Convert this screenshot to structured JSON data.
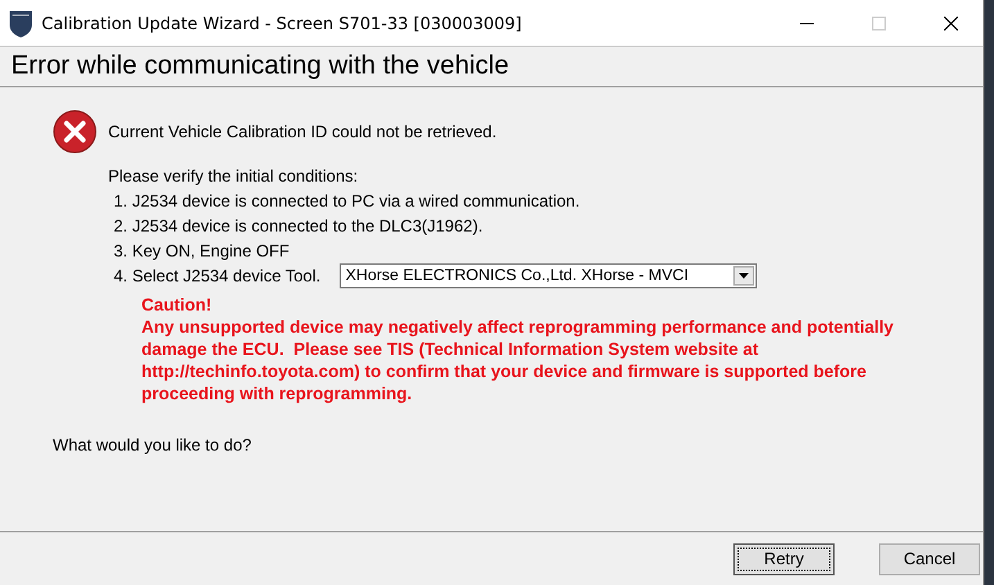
{
  "window": {
    "title": "Calibration Update Wizard - Screen S701-33 [030003009]"
  },
  "header": "Error while communicating with the vehicle",
  "message": "Current Vehicle Calibration ID could not be retrieved.",
  "intro": "Please verify the initial conditions:",
  "conditions": [
    {
      "kind": "text",
      "text": "1. J2534 device is connected to PC via a wired communication."
    },
    {
      "kind": "text",
      "text": "2. J2534 device is connected to the DLC3(J1962)."
    },
    {
      "kind": "text",
      "text": "3. Key ON, Engine OFF"
    },
    {
      "kind": "select",
      "text": "4. Select J2534 device Tool.",
      "value": "XHorse ELECTRONICS Co.,Ltd.  XHorse - MVCI"
    }
  ],
  "caution_title": "Caution!",
  "caution_text": "Any unsupported device may negatively affect reprogramming performance and potentially damage the ECU.  Please see TIS (Technical Information System website at http://techinfo.toyota.com) to confirm that your device and firmware is supported before proceeding with reprogramming.",
  "question": "What would you like to do?",
  "buttons": [
    {
      "label": "Retry",
      "selected": true
    },
    {
      "label": "Cancel",
      "selected": false
    }
  ]
}
